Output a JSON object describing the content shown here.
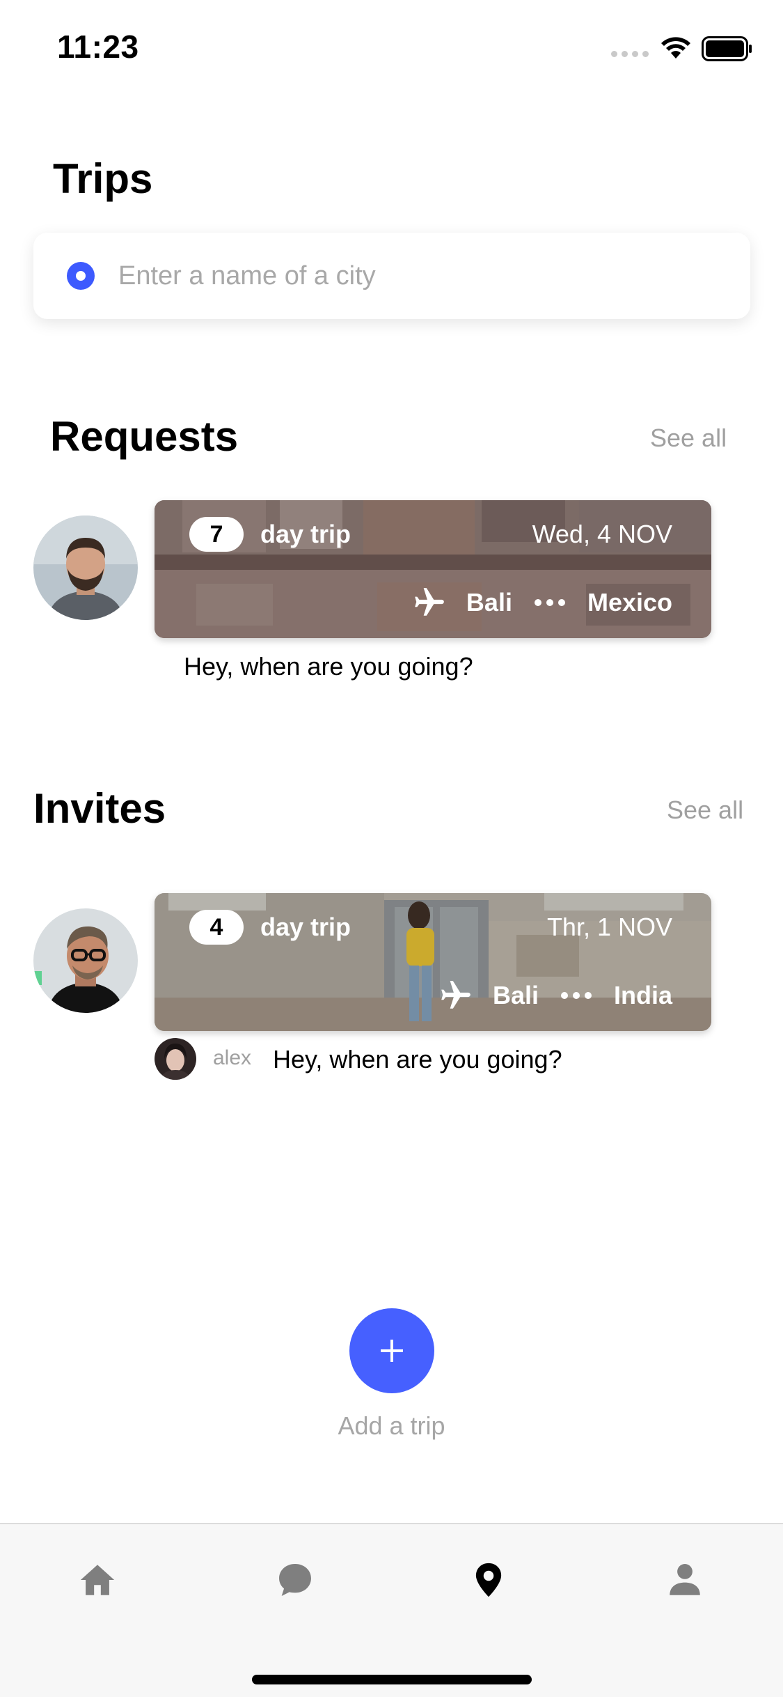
{
  "status_bar": {
    "time": "11:23"
  },
  "page": {
    "title": "Trips"
  },
  "search": {
    "placeholder": "Enter a name of a city",
    "value": ""
  },
  "requests": {
    "title": "Requests",
    "see_all": "See all",
    "items": [
      {
        "days": "7",
        "day_trip_label": "day trip",
        "date": "Wed, 4 NOV",
        "from": "Bali",
        "to": "Mexico",
        "message": "Hey, when are you going?"
      }
    ]
  },
  "invites": {
    "title": "Invites",
    "see_all": "See all",
    "items": [
      {
        "days": "4",
        "day_trip_label": "day trip",
        "date": "Thr, 1 NOV",
        "from": "Bali",
        "to": "India",
        "sender": "alex",
        "message": "Hey, when are you going?"
      }
    ]
  },
  "add_trip": {
    "label": "Add a trip"
  },
  "tab_bar": {
    "items": [
      {
        "icon": "home-icon",
        "active": false
      },
      {
        "icon": "chat-icon",
        "active": false
      },
      {
        "icon": "location-pin-icon",
        "active": true
      },
      {
        "icon": "profile-icon",
        "active": false
      }
    ]
  },
  "colors": {
    "accent": "#4660ff",
    "radio": "#3d5afe",
    "muted_text": "#a0a0a0",
    "tab_inactive": "#7f7f7f",
    "tab_active": "#000000"
  }
}
